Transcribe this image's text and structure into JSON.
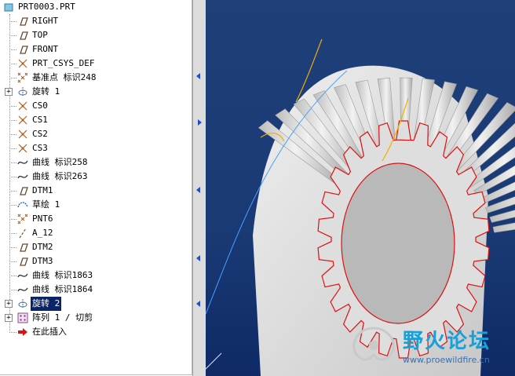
{
  "tree": {
    "items": [
      {
        "label": "PRT0003.PRT",
        "icon": "part-icon",
        "indent": 0
      },
      {
        "label": "RIGHT",
        "icon": "datum-plane-icon",
        "indent": 1
      },
      {
        "label": "TOP",
        "icon": "datum-plane-icon",
        "indent": 1
      },
      {
        "label": "FRONT",
        "icon": "datum-plane-icon",
        "indent": 1
      },
      {
        "label": "PRT_CSYS_DEF",
        "icon": "csys-icon",
        "indent": 1
      },
      {
        "label": "基准点 标识248",
        "icon": "datum-point-icon",
        "indent": 1
      },
      {
        "label": "旋转 1",
        "icon": "revolve-icon",
        "indent": 1,
        "expander": "+"
      },
      {
        "label": "CS0",
        "icon": "csys-icon",
        "indent": 1
      },
      {
        "label": "CS1",
        "icon": "csys-icon",
        "indent": 1
      },
      {
        "label": "CS2",
        "icon": "csys-icon",
        "indent": 1
      },
      {
        "label": "CS3",
        "icon": "csys-icon",
        "indent": 1
      },
      {
        "label": "曲线 标识258",
        "icon": "curve-icon",
        "indent": 1
      },
      {
        "label": "曲线 标识263",
        "icon": "curve-icon",
        "indent": 1
      },
      {
        "label": "DTM1",
        "icon": "datum-plane-icon",
        "indent": 1
      },
      {
        "label": "草绘 1",
        "icon": "sketch-icon",
        "indent": 1
      },
      {
        "label": "PNT6",
        "icon": "datum-point-icon",
        "indent": 1
      },
      {
        "label": "A_12",
        "icon": "axis-icon",
        "indent": 1
      },
      {
        "label": "DTM2",
        "icon": "datum-plane-icon",
        "indent": 1
      },
      {
        "label": "DTM3",
        "icon": "datum-plane-icon",
        "indent": 1
      },
      {
        "label": "曲线 标识1863",
        "icon": "curve-icon",
        "indent": 1
      },
      {
        "label": "曲线 标识1864",
        "icon": "curve-icon",
        "indent": 1
      },
      {
        "label": "旋转 2",
        "icon": "revolve-icon",
        "indent": 1,
        "expander": "+",
        "selected": true
      },
      {
        "label": "阵列 1 / 切剪",
        "icon": "pattern-icon",
        "indent": 1,
        "expander": "+"
      },
      {
        "label": "在此插入",
        "icon": "insert-here-arrow-icon",
        "indent": 1
      }
    ]
  },
  "watermark": {
    "title": "野火论坛",
    "url": "www.proewildfire.cn"
  },
  "colors": {
    "selection": "#0a246a",
    "viewport_bg": "#1a3a76",
    "gear": "#d8d8d8",
    "edge": "#e01010",
    "curve": "#f0b000"
  }
}
